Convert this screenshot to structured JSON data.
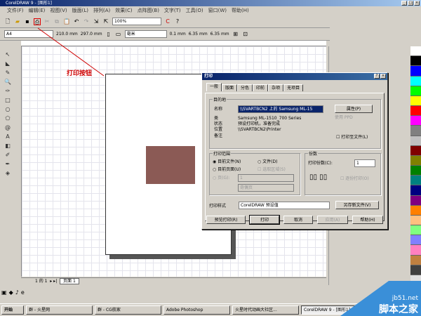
{
  "window": {
    "title": "CorelDRAW 9 - [图形1]"
  },
  "menu": [
    "文件(F)",
    "编辑(E)",
    "视图(V)",
    "版面(L)",
    "排列(A)",
    "效果(C)",
    "点阵图(B)",
    "文字(T)",
    "工具(O)",
    "窗口(W)",
    "帮助(H)"
  ],
  "toolbar": {
    "zoom": "100%",
    "paper": "A4",
    "width": "210.0 mm",
    "height": "297.0 mm",
    "units": "毫米",
    "nudge": "0.1 mm",
    "dup_x": "6.35 mm",
    "dup_y": "6.35 mm"
  },
  "annotation": "打印按钮",
  "colors": {
    "rect": "#8b5a55",
    "annotation": "#d00000",
    "title": "#0a246a"
  },
  "status": {
    "page_counter": "1 的 1",
    "page_tab": "页面 1"
  },
  "dialog": {
    "title": "打印",
    "tabs": [
      "一般",
      "版面",
      "分色",
      "印前",
      "杂项",
      "无项目"
    ],
    "destination": {
      "label": "目的地",
      "name_label": "名称",
      "name_value": "\\\\SVARTBCN2 上的 Samsung ML-15",
      "properties": "属性(P)",
      "print_to_file_dis": "使用 PPD",
      "type_label": "类",
      "type_value": "Samsung ML-1510_700 Series",
      "status_label": "状态",
      "status_value": "预设打印机，准备完成",
      "where_label": "位置",
      "where_value": "\\\\SVARTBCN2\\Printer",
      "comment_label": "备注",
      "print_to_file": "打印至文件(L)"
    },
    "range": {
      "label": "打印范围",
      "current_doc": "目前文件(N)",
      "documents": "文件(D)",
      "current_page": "目前页面(U)",
      "selection": "选取区域(S)",
      "pages": "页(G):",
      "pages_value": "1",
      "even_odd": "奇偶页"
    },
    "copies": {
      "label": "份数",
      "count_label": "打印份数(C):",
      "count_value": "1",
      "collate": "逐份打印(O)"
    },
    "style": {
      "label": "打印样式",
      "value": "CorelDRAW 预设值",
      "save_as": "另存新文件(V)"
    },
    "buttons": {
      "preview": "预览打印(R)",
      "print": "打印",
      "cancel": "取消",
      "apply": "应用(A)",
      "help": "帮助(H)"
    }
  },
  "taskbar": {
    "start": "开始",
    "tasks": [
      "群 - 火星网",
      "群 - CG航家",
      "Adobe Photoshop",
      "火星时代动画大社区...",
      "CorelDRAW 9 - [图形1]"
    ]
  },
  "watermark": {
    "site": "jb51.net",
    "name": "脚本之家"
  }
}
